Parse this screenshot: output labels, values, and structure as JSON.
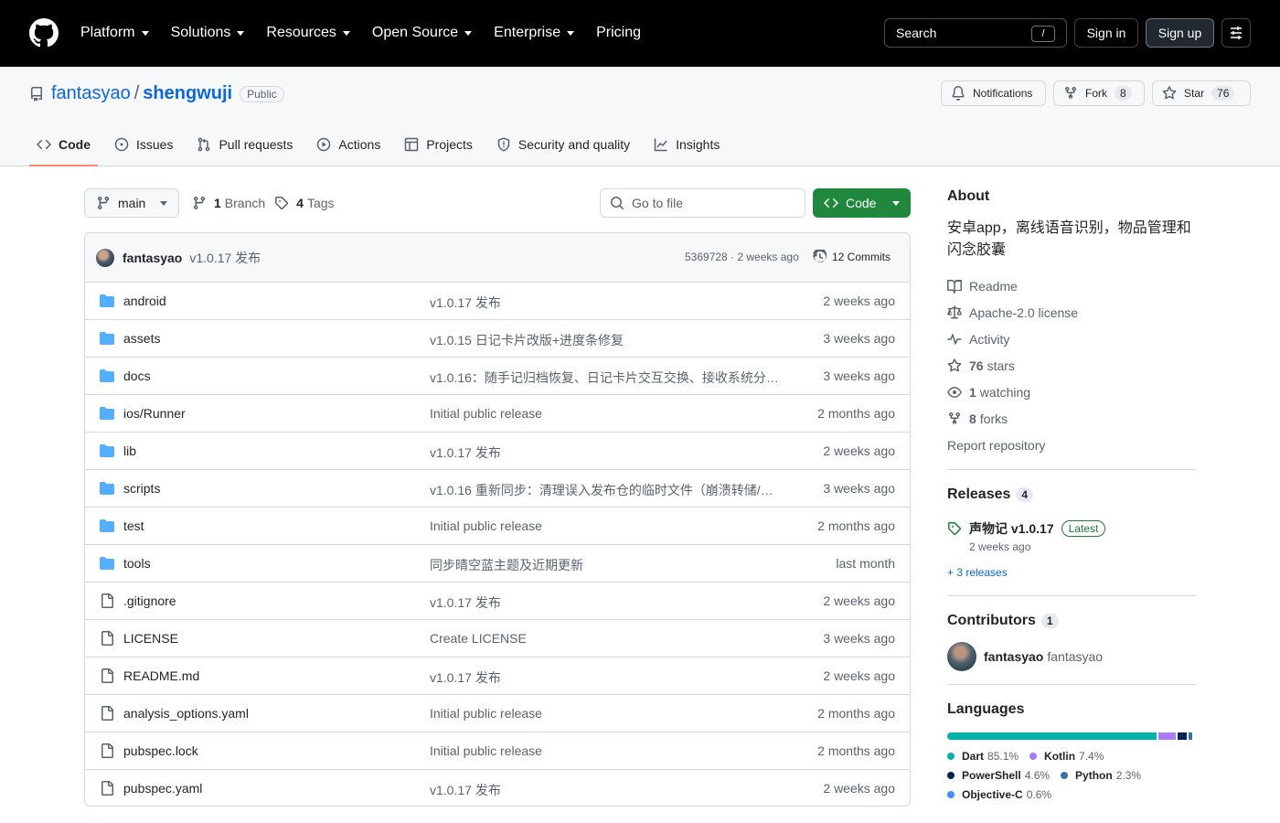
{
  "header": {
    "nav": [
      {
        "label": "Platform",
        "dropdown": true
      },
      {
        "label": "Solutions",
        "dropdown": true
      },
      {
        "label": "Resources",
        "dropdown": true
      },
      {
        "label": "Open Source",
        "dropdown": true
      },
      {
        "label": "Enterprise",
        "dropdown": true
      },
      {
        "label": "Pricing",
        "dropdown": false
      }
    ],
    "search_label": "Search",
    "search_shortcut": "/",
    "sign_in": "Sign in",
    "sign_up": "Sign up"
  },
  "repo": {
    "owner": "fantasyao",
    "separator": "/",
    "name": "shengwuji",
    "visibility": "Public",
    "notifications_label": "Notifications",
    "fork_label": "Fork",
    "fork_count": "8",
    "star_label": "Star",
    "star_count": "76"
  },
  "tabs": [
    {
      "label": "Code",
      "icon": "code-icon",
      "active": true
    },
    {
      "label": "Issues",
      "icon": "issue-icon"
    },
    {
      "label": "Pull requests",
      "icon": "pull-request-icon"
    },
    {
      "label": "Actions",
      "icon": "play-icon"
    },
    {
      "label": "Projects",
      "icon": "table-icon"
    },
    {
      "label": "Security and quality",
      "icon": "shield-icon"
    },
    {
      "label": "Insights",
      "icon": "graph-icon"
    }
  ],
  "toolbar": {
    "branch": "main",
    "branch_count": "1",
    "branch_label": "Branch",
    "tag_count": "4",
    "tag_label": "Tags",
    "goto_placeholder": "Go to file",
    "code_button": "Code"
  },
  "latest_commit": {
    "author": "fantasyao",
    "message": "v1.0.17 发布",
    "hash_time": "5369728 · 2 weeks ago",
    "commits": "12 Commits"
  },
  "files": [
    {
      "name": "android",
      "type": "dir",
      "message": "v1.0.17 发布",
      "date": "2 weeks ago"
    },
    {
      "name": "assets",
      "type": "dir",
      "message": "v1.0.15 日记卡片改版+进度条修复",
      "date": "3 weeks ago"
    },
    {
      "name": "docs",
      "type": "dir",
      "message": "v1.0.16：随手记归档恢复、日记卡片交互交换、接收系统分…",
      "date": "3 weeks ago"
    },
    {
      "name": "ios/Runner",
      "type": "dir",
      "message": "Initial public release",
      "date": "2 months ago"
    },
    {
      "name": "lib",
      "type": "dir",
      "message": "v1.0.17 发布",
      "date": "2 weeks ago"
    },
    {
      "name": "scripts",
      "type": "dir",
      "message": "v1.0.16 重新同步：清理误入发布仓的临时文件（崩溃转储/…",
      "date": "3 weeks ago"
    },
    {
      "name": "test",
      "type": "dir",
      "message": "Initial public release",
      "date": "2 months ago"
    },
    {
      "name": "tools",
      "type": "dir",
      "message": "同步晴空蓝主题及近期更新",
      "date": "last month"
    },
    {
      "name": ".gitignore",
      "type": "file",
      "message": "v1.0.17 发布",
      "date": "2 weeks ago"
    },
    {
      "name": "LICENSE",
      "type": "file",
      "message": "Create LICENSE",
      "date": "3 weeks ago"
    },
    {
      "name": "README.md",
      "type": "file",
      "message": "v1.0.17 发布",
      "date": "2 weeks ago"
    },
    {
      "name": "analysis_options.yaml",
      "type": "file",
      "message": "Initial public release",
      "date": "2 months ago"
    },
    {
      "name": "pubspec.lock",
      "type": "file",
      "message": "Initial public release",
      "date": "2 months ago"
    },
    {
      "name": "pubspec.yaml",
      "type": "file",
      "message": "v1.0.17 发布",
      "date": "2 weeks ago"
    }
  ],
  "about": {
    "title": "About",
    "description": "安卓app，离线语音识别，物品管理和闪念胶囊",
    "readme": "Readme",
    "license": "Apache-2.0 license",
    "activity": "Activity",
    "stars_count": "76",
    "stars_label": "stars",
    "watching_count": "1",
    "watching_label": "watching",
    "forks_count": "8",
    "forks_label": "forks",
    "report": "Report repository"
  },
  "releases": {
    "title": "Releases",
    "count": "4",
    "latest_name": "声物记 v1.0.17",
    "latest_badge": "Latest",
    "latest_date": "2 weeks ago",
    "more": "+ 3 releases"
  },
  "contributors": {
    "title": "Contributors",
    "count": "1",
    "login": "fantasyao",
    "name": "fantasyao"
  },
  "languages": {
    "title": "Languages",
    "items": [
      {
        "name": "Dart",
        "percent": "85.1%",
        "value": 85.1,
        "color": "#00b4ab"
      },
      {
        "name": "Kotlin",
        "percent": "7.4%",
        "value": 7.4,
        "color": "#a97bff"
      },
      {
        "name": "PowerShell",
        "percent": "4.6%",
        "value": 4.6,
        "color": "#012456"
      },
      {
        "name": "Python",
        "percent": "2.3%",
        "value": 2.3,
        "color": "#3572a5"
      },
      {
        "name": "Objective-C",
        "percent": "0.6%",
        "value": 0.6,
        "color": "#438eff"
      }
    ]
  }
}
